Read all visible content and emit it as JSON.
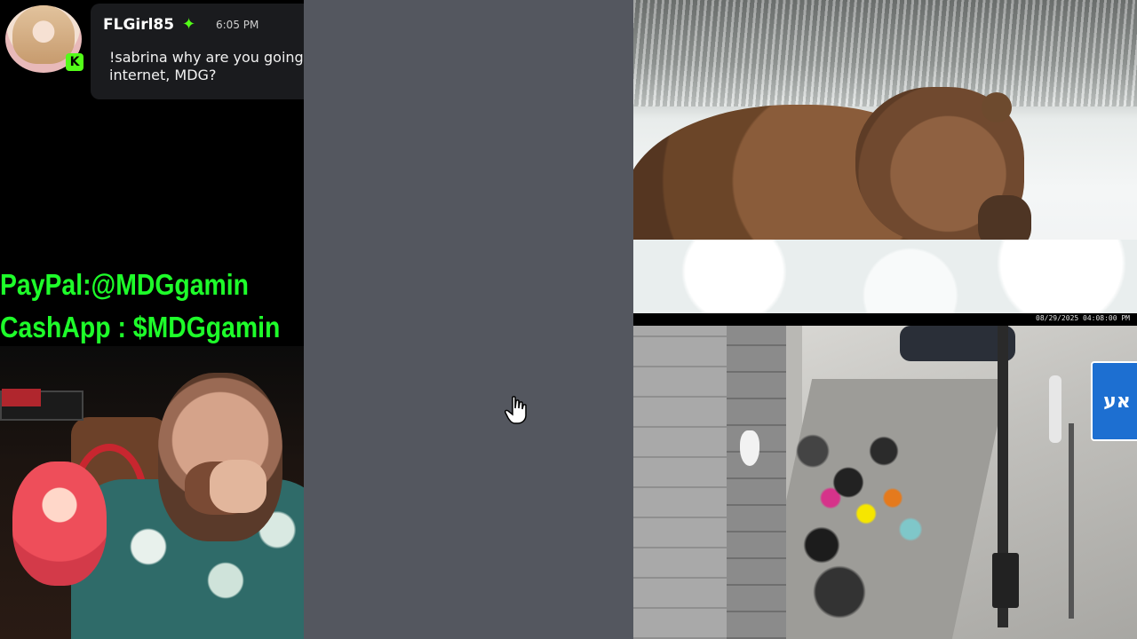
{
  "chat": {
    "username": "FLGirl85",
    "user_badge_icon": "green-sparkle-icon",
    "timestamp": "6:05 PM",
    "message": "!sabrina why are you going to lose internet, MDG?",
    "platform_badge": "K",
    "accent_color": "#53fc18"
  },
  "overlay": {
    "paypal": "PayPal:@MDGgamin",
    "cashapp": "CashApp : $MDGgamin",
    "text_color": "#1eff2a"
  },
  "videos": {
    "street_cam_timestamp": "08/29/2025 04:08:00 PM",
    "street_sign_text": "אע"
  },
  "colors": {
    "middle_panel": "#54575f",
    "background": "#000000"
  }
}
